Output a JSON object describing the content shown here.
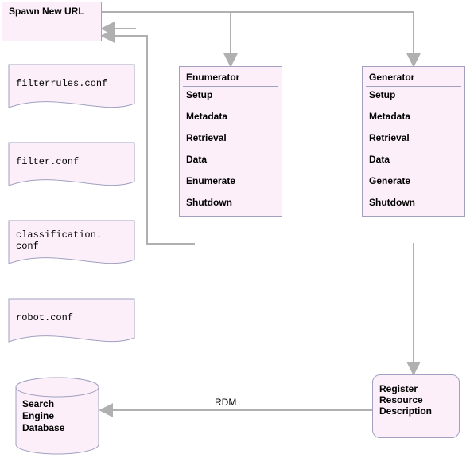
{
  "diagram": {
    "spawn": {
      "title": "Spawn New URL"
    },
    "enumerator": {
      "title": "Enumerator",
      "items": [
        "Setup",
        "Metadata",
        "Retrieval",
        "Data",
        "Enumerate",
        "Shutdown"
      ]
    },
    "generator": {
      "title": "Generator",
      "items": [
        "Setup",
        "Metadata",
        "Retrieval",
        "Data",
        "Generate",
        "Shutdown"
      ]
    },
    "docs": {
      "filterrules": "filterrules.conf",
      "filter": "filter.conf",
      "classification": "classification.\nconf",
      "robot": "robot.conf"
    },
    "register": {
      "line1": "Register",
      "line2": "Resource",
      "line3": "Description"
    },
    "db": {
      "line1": "Search",
      "line2": "Engine",
      "line3": "Database"
    },
    "edges": {
      "rdm": "RDM"
    }
  },
  "chart_data": {
    "type": "diagram",
    "title": "",
    "nodes": [
      {
        "id": "spawn",
        "kind": "box",
        "label": "Spawn New URL"
      },
      {
        "id": "enumerator",
        "kind": "module",
        "label": "Enumerator",
        "operations": [
          "Setup",
          "Metadata",
          "Retrieval",
          "Data",
          "Enumerate",
          "Shutdown"
        ]
      },
      {
        "id": "generator",
        "kind": "module",
        "label": "Generator",
        "operations": [
          "Setup",
          "Metadata",
          "Retrieval",
          "Data",
          "Generate",
          "Shutdown"
        ]
      },
      {
        "id": "filterrules_conf",
        "kind": "file",
        "label": "filterrules.conf"
      },
      {
        "id": "filter_conf",
        "kind": "file",
        "label": "filter.conf"
      },
      {
        "id": "classification_conf",
        "kind": "file",
        "label": "classification.conf"
      },
      {
        "id": "robot_conf",
        "kind": "file",
        "label": "robot.conf"
      },
      {
        "id": "register",
        "kind": "box",
        "label": "Register Resource Description"
      },
      {
        "id": "db",
        "kind": "datastore",
        "label": "Search Engine Database"
      }
    ],
    "edges": [
      {
        "from": "spawn",
        "to": "enumerator"
      },
      {
        "from": "spawn",
        "to": "generator"
      },
      {
        "from": "enumerator",
        "to": "spawn"
      },
      {
        "from": "filterrules_conf",
        "to": "spawn"
      },
      {
        "from": "generator",
        "to": "register"
      },
      {
        "from": "register",
        "to": "db",
        "label": "RDM"
      }
    ]
  }
}
